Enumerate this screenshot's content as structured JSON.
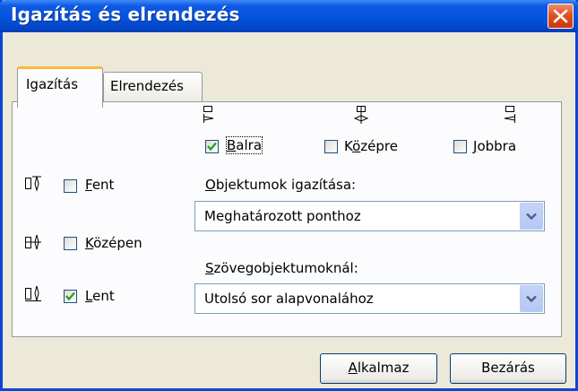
{
  "window": {
    "title": "Igazítás és elrendezés"
  },
  "tabs": [
    {
      "label": "Igazítás",
      "active": true
    },
    {
      "label": "Elrendezés",
      "active": false
    }
  ],
  "horizontal": {
    "left": {
      "label": "Balra",
      "mnemonic": "B",
      "rest": "alra",
      "checked": true
    },
    "center": {
      "label": "Középre",
      "mnemonic": "ö",
      "pre": "K",
      "rest": "zépre",
      "checked": false
    },
    "right": {
      "label": "Jobbra",
      "mnemonic": "J",
      "rest": "obbra",
      "checked": false
    }
  },
  "vertical": {
    "top": {
      "label": "Fent",
      "mnemonic": "F",
      "rest": "ent",
      "checked": false
    },
    "middle": {
      "label": "Középen",
      "mnemonic": "K",
      "rest": "özépen",
      "checked": false
    },
    "bottom": {
      "label": "Lent",
      "mnemonic": "L",
      "rest": "ent",
      "checked": true
    }
  },
  "object_align": {
    "label": "Objektumok igazítása:",
    "mnemonic": "O",
    "rest": "bjektumok igazítása:",
    "value": "Meghatározott ponthoz"
  },
  "text_objects": {
    "label": "Szövegobjektumoknál:",
    "mnemonic": "S",
    "rest": "zövegobjektumoknál:",
    "value": "Utolsó sor alapvonalához"
  },
  "buttons": {
    "apply": {
      "label": "Alkalmaz",
      "mnemonic": "A",
      "rest": "lkalmaz"
    },
    "close": {
      "label": "Bezárás"
    }
  },
  "colors": {
    "title_bar": "#0553dc",
    "dialog_bg": "#ece9d8",
    "tab_highlight": "#fbb93c",
    "checkmark": "#21a121",
    "close_button": "#e04d1d"
  }
}
